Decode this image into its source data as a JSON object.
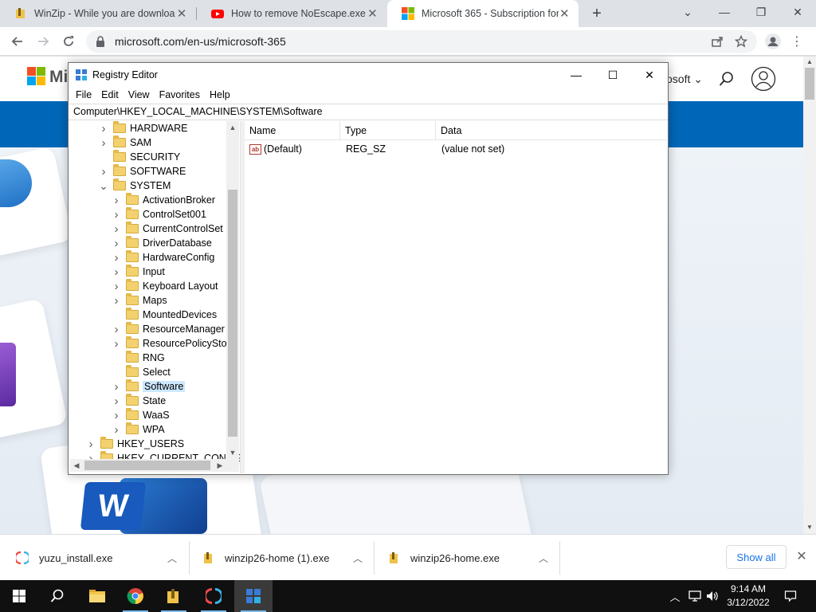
{
  "browser": {
    "tabs": [
      {
        "title": "WinZip - While you are downloading"
      },
      {
        "title": "How to remove NoEscape.exe [D"
      },
      {
        "title": "Microsoft 365 - Subscription for"
      }
    ],
    "url": "microsoft.com/en-us/microsoft-365"
  },
  "page": {
    "brand_partial": "Mi",
    "header_right": "osoft ⌄",
    "word_letter": "W"
  },
  "regedit": {
    "title": "Registry Editor",
    "menu": [
      "File",
      "Edit",
      "View",
      "Favorites",
      "Help"
    ],
    "address": "Computer\\HKEY_LOCAL_MACHINE\\SYSTEM\\Software",
    "tree": [
      {
        "label": "HARDWARE",
        "level": 1,
        "expander": "collapsed"
      },
      {
        "label": "SAM",
        "level": 1,
        "expander": "collapsed"
      },
      {
        "label": "SECURITY",
        "level": 1,
        "expander": "none"
      },
      {
        "label": "SOFTWARE",
        "level": 1,
        "expander": "collapsed"
      },
      {
        "label": "SYSTEM",
        "level": 1,
        "expander": "expanded"
      },
      {
        "label": "ActivationBroker",
        "level": 2,
        "expander": "collapsed"
      },
      {
        "label": "ControlSet001",
        "level": 2,
        "expander": "collapsed"
      },
      {
        "label": "CurrentControlSet",
        "level": 2,
        "expander": "collapsed"
      },
      {
        "label": "DriverDatabase",
        "level": 2,
        "expander": "collapsed"
      },
      {
        "label": "HardwareConfig",
        "level": 2,
        "expander": "collapsed"
      },
      {
        "label": "Input",
        "level": 2,
        "expander": "collapsed"
      },
      {
        "label": "Keyboard Layout",
        "level": 2,
        "expander": "collapsed"
      },
      {
        "label": "Maps",
        "level": 2,
        "expander": "collapsed"
      },
      {
        "label": "MountedDevices",
        "level": 2,
        "expander": "none"
      },
      {
        "label": "ResourceManager",
        "level": 2,
        "expander": "collapsed"
      },
      {
        "label": "ResourcePolicyStore",
        "level": 2,
        "expander": "collapsed"
      },
      {
        "label": "RNG",
        "level": 2,
        "expander": "none"
      },
      {
        "label": "Select",
        "level": 2,
        "expander": "none"
      },
      {
        "label": "Software",
        "level": 2,
        "expander": "collapsed",
        "selected": true
      },
      {
        "label": "State",
        "level": 2,
        "expander": "collapsed"
      },
      {
        "label": "WaaS",
        "level": 2,
        "expander": "collapsed"
      },
      {
        "label": "WPA",
        "level": 2,
        "expander": "collapsed"
      },
      {
        "label": "HKEY_USERS",
        "level": 0,
        "expander": "collapsed"
      },
      {
        "label": "HKEY_CURRENT_CONFIG",
        "level": 0,
        "expander": "collapsed"
      }
    ],
    "columns": [
      "Name",
      "Type",
      "Data"
    ],
    "values": [
      {
        "name": "(Default)",
        "type": "REG_SZ",
        "data": "(value not set)",
        "icon": "ab"
      }
    ]
  },
  "downloads": {
    "items": [
      {
        "name": "yuzu_install.exe"
      },
      {
        "name": "winzip26-home (1).exe"
      },
      {
        "name": "winzip26-home.exe"
      }
    ],
    "show_all": "Show all"
  },
  "taskbar": {
    "time": "9:14 AM",
    "date": "3/12/2022"
  },
  "colors": {
    "ms_blue_band": "#0067b8",
    "selection": "#cce8ff",
    "link_blue": "#1a73e8",
    "taskbar": "#101010"
  }
}
